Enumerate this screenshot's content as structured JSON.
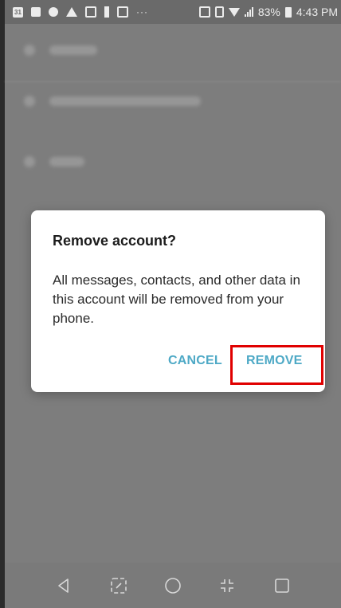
{
  "status_bar": {
    "left_icons": [
      "calendar-icon",
      "video-icon",
      "reddit-icon",
      "alert-icon",
      "lock-icon",
      "tie-icon",
      "image-icon",
      "more-icon"
    ],
    "right_icons": [
      "nfc-icon",
      "vibrate-icon",
      "wifi-icon",
      "signal-icon",
      "battery-icon"
    ],
    "calendar_day": "31",
    "battery_percent": "83%",
    "time": "4:43 PM"
  },
  "dialog": {
    "title": "Remove account?",
    "message": "All messages, contacts, and other data in this account will be removed from your phone.",
    "cancel_label": "CANCEL",
    "remove_label": "REMOVE"
  },
  "colors": {
    "accent": "#4ea9c6",
    "highlight": "#e00000",
    "scrim": "#7c7c7c"
  },
  "nav_bar": {
    "icons": [
      "back-icon",
      "capture-icon",
      "home-icon",
      "dual-window-icon",
      "recents-icon"
    ]
  }
}
